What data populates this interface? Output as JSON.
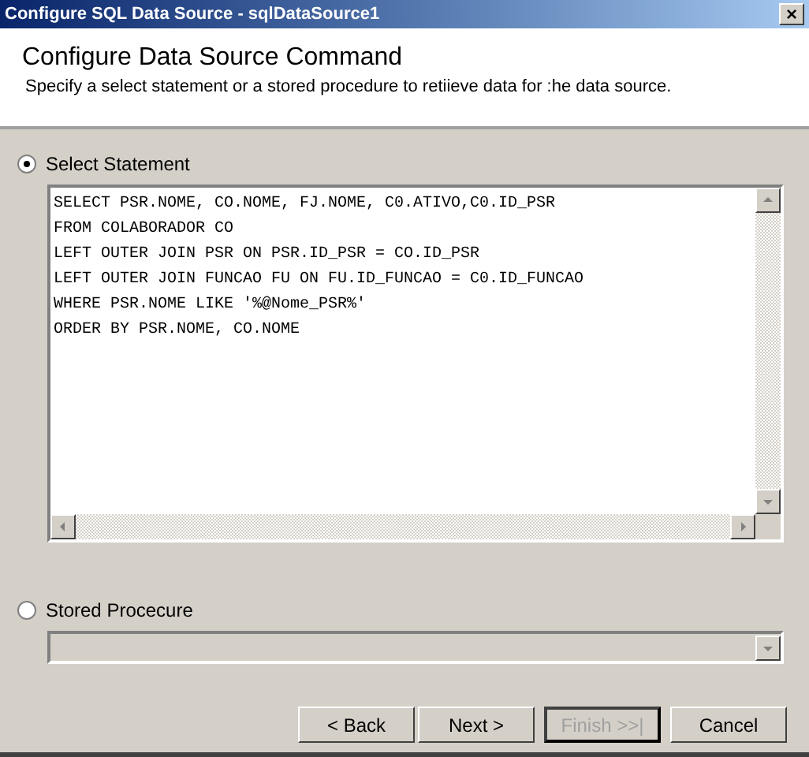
{
  "window": {
    "title": "Configure SQL Data Source - sqlDataSource1",
    "close": "×"
  },
  "header": {
    "title": "Configure Data Source Command",
    "description": "Specify a select statement or a stored procedure to retiieve data for :he data source."
  },
  "options": [
    {
      "label": "Select Statement",
      "selected": true,
      "kind": "editor",
      "lines": [
        "SELECT PSR.NOME, CO.NOME, FJ.NOME, C0.ATIVO,C0.ID_PSR",
        "FROM COLABORADOR CO",
        "LEFT OUTER JOIN PSR ON PSR.ID_PSR = CO.ID_PSR",
        "LEFT OUTER JOIN FUNCAO FU ON FU.ID_FUNCAO = C0.ID_FUNCAO",
        "WHERE PSR.NOME LIKE '%@Nome_PSR%'",
        "ORDER BY PSR.NOME, CO.NOME"
      ]
    },
    {
      "label": "Stored Procecure",
      "selected": false,
      "kind": "dropdown",
      "disabled": true
    }
  ],
  "buttons": [
    {
      "label": "< Back",
      "disabled": false,
      "default": false
    },
    {
      "label": "Next >",
      "disabled": false,
      "default": false
    },
    {
      "label": "Finish >>|",
      "disabled": true,
      "default": true
    },
    {
      "label": "Cancel",
      "disabled": false,
      "default": false
    }
  ]
}
